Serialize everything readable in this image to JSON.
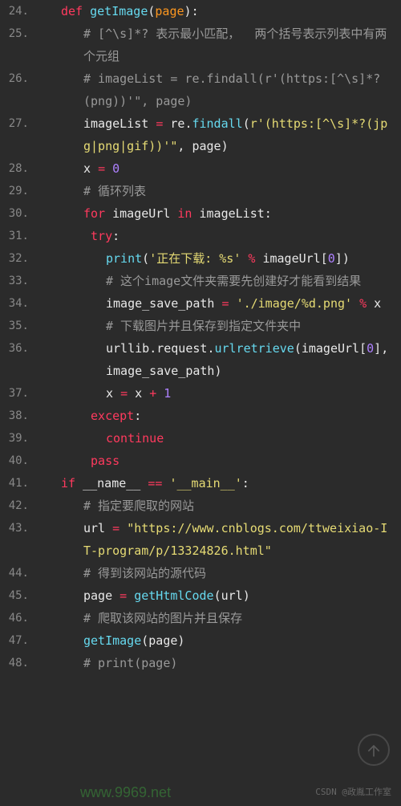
{
  "lines": [
    {
      "num": "24.",
      "indent": 1,
      "segments": [
        {
          "t": "def ",
          "c": "keyword"
        },
        {
          "t": "getImage",
          "c": "def-name"
        },
        {
          "t": "(",
          "c": "paren"
        },
        {
          "t": "page",
          "c": "param"
        },
        {
          "t": ")",
          "c": "paren"
        },
        {
          "t": ":",
          "c": "colon"
        }
      ]
    },
    {
      "num": "25.",
      "indent": 2,
      "segments": [
        {
          "t": "# [^\\s]*? 表示最小匹配，  两个括号表示列表中有两个元组",
          "c": "comment"
        }
      ]
    },
    {
      "num": "26.",
      "indent": 2,
      "segments": [
        {
          "t": "# imageList = re.findall(r'(https:[^\\s]*?(png))'\", page)",
          "c": "comment"
        }
      ]
    },
    {
      "num": "27.",
      "indent": 2,
      "segments": [
        {
          "t": "imageList ",
          "c": "identifier"
        },
        {
          "t": "= ",
          "c": "operator"
        },
        {
          "t": "re",
          "c": "identifier"
        },
        {
          "t": ".",
          "c": "identifier"
        },
        {
          "t": "findall",
          "c": "func"
        },
        {
          "t": "(",
          "c": "paren"
        },
        {
          "t": "r'(https:[^\\s]*?(jpg|png|gif))'\"",
          "c": "string"
        },
        {
          "t": ", ",
          "c": "comma"
        },
        {
          "t": "page",
          "c": "identifier"
        },
        {
          "t": ")",
          "c": "paren"
        }
      ]
    },
    {
      "num": "28.",
      "indent": 2,
      "segments": [
        {
          "t": "x ",
          "c": "identifier"
        },
        {
          "t": "= ",
          "c": "operator"
        },
        {
          "t": "0",
          "c": "number"
        }
      ]
    },
    {
      "num": "29.",
      "indent": 2,
      "segments": [
        {
          "t": "# 循环列表",
          "c": "comment"
        }
      ]
    },
    {
      "num": "30.",
      "indent": 2,
      "segments": [
        {
          "t": "for ",
          "c": "keyword"
        },
        {
          "t": "imageUrl ",
          "c": "identifier"
        },
        {
          "t": "in ",
          "c": "keyword"
        },
        {
          "t": "imageList",
          "c": "identifier"
        },
        {
          "t": ":",
          "c": "colon"
        }
      ]
    },
    {
      "num": "31.",
      "indent": 2,
      "segments": [
        {
          "t": " ",
          "c": ""
        },
        {
          "t": "try",
          "c": "keyword"
        },
        {
          "t": ":",
          "c": "colon"
        }
      ]
    },
    {
      "num": "32.",
      "indent": 3,
      "segments": [
        {
          "t": "print",
          "c": "func"
        },
        {
          "t": "(",
          "c": "paren"
        },
        {
          "t": "'正在下载: %s'",
          "c": "string"
        },
        {
          "t": " % ",
          "c": "operator"
        },
        {
          "t": "imageUrl",
          "c": "identifier"
        },
        {
          "t": "[",
          "c": "brace"
        },
        {
          "t": "0",
          "c": "number"
        },
        {
          "t": "]",
          "c": "brace"
        },
        {
          "t": ")",
          "c": "paren"
        }
      ]
    },
    {
      "num": "33.",
      "indent": 3,
      "segments": [
        {
          "t": "# 这个image文件夹需要先创建好才能看到结果",
          "c": "comment"
        }
      ]
    },
    {
      "num": "34.",
      "indent": 3,
      "segments": [
        {
          "t": "image_save_path ",
          "c": "identifier"
        },
        {
          "t": "= ",
          "c": "operator"
        },
        {
          "t": "'./image/%d.png'",
          "c": "string"
        },
        {
          "t": " % ",
          "c": "operator"
        },
        {
          "t": "x",
          "c": "identifier"
        }
      ]
    },
    {
      "num": "35.",
      "indent": 3,
      "segments": [
        {
          "t": "# 下载图片并且保存到指定文件夹中",
          "c": "comment"
        }
      ]
    },
    {
      "num": "36.",
      "indent": 3,
      "segments": [
        {
          "t": "urllib",
          "c": "identifier"
        },
        {
          "t": ".",
          "c": "identifier"
        },
        {
          "t": "request",
          "c": "identifier"
        },
        {
          "t": ".",
          "c": "identifier"
        },
        {
          "t": "urlretrieve",
          "c": "func"
        },
        {
          "t": "(",
          "c": "paren"
        },
        {
          "t": "imageUrl",
          "c": "identifier"
        },
        {
          "t": "[",
          "c": "brace"
        },
        {
          "t": "0",
          "c": "number"
        },
        {
          "t": "]",
          "c": "brace"
        },
        {
          "t": ", ",
          "c": "comma"
        },
        {
          "t": "image_save_path",
          "c": "identifier"
        },
        {
          "t": ")",
          "c": "paren"
        }
      ]
    },
    {
      "num": "37.",
      "indent": 3,
      "segments": [
        {
          "t": "x ",
          "c": "identifier"
        },
        {
          "t": "= ",
          "c": "operator"
        },
        {
          "t": "x ",
          "c": "identifier"
        },
        {
          "t": "+ ",
          "c": "operator"
        },
        {
          "t": "1",
          "c": "number"
        }
      ]
    },
    {
      "num": "38.",
      "indent": 2,
      "segments": [
        {
          "t": " ",
          "c": ""
        },
        {
          "t": "except",
          "c": "keyword"
        },
        {
          "t": ":",
          "c": "colon"
        }
      ]
    },
    {
      "num": "39.",
      "indent": 3,
      "segments": [
        {
          "t": "continue",
          "c": "keyword"
        }
      ]
    },
    {
      "num": "40.",
      "indent": 2,
      "segments": [
        {
          "t": " ",
          "c": ""
        },
        {
          "t": "pass",
          "c": "keyword"
        }
      ]
    },
    {
      "num": "41.",
      "indent": 1,
      "segments": [
        {
          "t": "if ",
          "c": "keyword"
        },
        {
          "t": "__name__ ",
          "c": "identifier"
        },
        {
          "t": "== ",
          "c": "operator"
        },
        {
          "t": "'__main__'",
          "c": "string"
        },
        {
          "t": ":",
          "c": "colon"
        }
      ]
    },
    {
      "num": "42.",
      "indent": 2,
      "segments": [
        {
          "t": "# 指定要爬取的网站",
          "c": "comment"
        }
      ]
    },
    {
      "num": "43.",
      "indent": 2,
      "segments": [
        {
          "t": "url ",
          "c": "identifier"
        },
        {
          "t": "= ",
          "c": "operator"
        },
        {
          "t": "\"https://www.cnblogs.com/ttweixiao-IT-program/p/13324826.html\"",
          "c": "string"
        }
      ]
    },
    {
      "num": "44.",
      "indent": 2,
      "segments": [
        {
          "t": "# 得到该网站的源代码",
          "c": "comment"
        }
      ]
    },
    {
      "num": "45.",
      "indent": 2,
      "segments": [
        {
          "t": "page ",
          "c": "identifier"
        },
        {
          "t": "= ",
          "c": "operator"
        },
        {
          "t": "getHtmlCode",
          "c": "func"
        },
        {
          "t": "(",
          "c": "paren"
        },
        {
          "t": "url",
          "c": "identifier"
        },
        {
          "t": ")",
          "c": "paren"
        }
      ]
    },
    {
      "num": "46.",
      "indent": 2,
      "segments": [
        {
          "t": "# 爬取该网站的图片并且保存",
          "c": "comment"
        }
      ]
    },
    {
      "num": "47.",
      "indent": 2,
      "segments": [
        {
          "t": "getImage",
          "c": "func"
        },
        {
          "t": "(",
          "c": "paren"
        },
        {
          "t": "page",
          "c": "identifier"
        },
        {
          "t": ")",
          "c": "paren"
        }
      ]
    },
    {
      "num": "48.",
      "indent": 2,
      "segments": [
        {
          "t": "# print(page)",
          "c": "comment"
        }
      ]
    }
  ],
  "watermark": "CSDN @政胤工作室",
  "watermark_url": "www.9969.net"
}
